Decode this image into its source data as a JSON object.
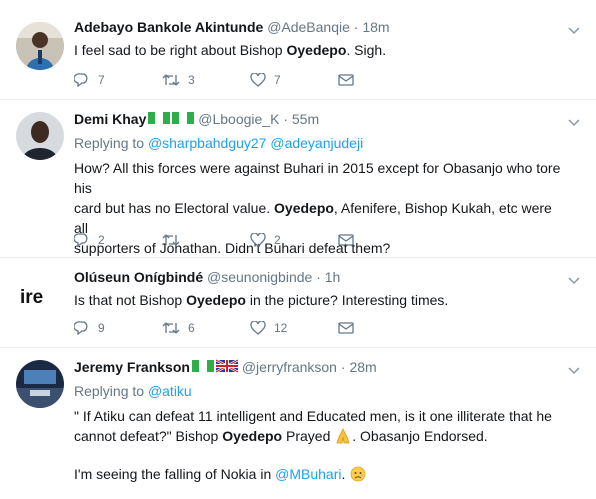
{
  "tweets": [
    {
      "name": "Adebayo Bankole Akintunde",
      "handle": "@AdeBanqie",
      "dot": "·",
      "time": "18m",
      "text_a": "I feel sad to be right about Bishop ",
      "text_b": "Oyedepo",
      "text_c": ". Sigh.",
      "replies": "7",
      "retweets": "3",
      "likes": "7"
    },
    {
      "name": "Demi Khay",
      "handle": "@Lboogie_K",
      "dot": "·",
      "time": "55m",
      "replying_label": "Replying to",
      "mention_1": "@sharpbahdguy27",
      "mention_2": "@adeyanjudeji",
      "line1": "How? All this forces were against Buhari in 2015 except for Obasanjo who tore his",
      "line2_a": "card but has no Electoral value. ",
      "line2_b": "Oyedepo",
      "line2_c": ", Afenifere, Bishop Kukah, etc were all",
      "line3": "supporters of Jonathan. Didn't Buhari defeat them?",
      "replies": "2",
      "retweets": "",
      "likes": "2"
    },
    {
      "name": "Olúseun Onígbindé",
      "handle": "@seunonigbinde",
      "dot": "·",
      "time": "1h",
      "avatar_text": "ire",
      "text_a": "Is that not Bishop ",
      "text_b": "Oyedepo",
      "text_c": " in the picture? Interesting times.",
      "replies": "9",
      "retweets": "6",
      "likes": "12"
    },
    {
      "name": "Jeremy Frankson",
      "handle": "@jerryfrankson",
      "dot": "·",
      "time": "28m",
      "replying_label": "Replying to",
      "mention_1": "@atiku",
      "line1": "\" If Atiku can defeat 11 intelligent and Educated men, is it one illiterate that he",
      "line2_a": "cannot defeat?\" Bishop ",
      "line2_b": "Oyedepo",
      "line2_c": " Prayed",
      "line2_d": ". Obasanjo Endorsed.",
      "line3_a": "I'm seeing the falling of Nokia in ",
      "line3_mention": "@MBuhari",
      "line3_c": "."
    }
  ],
  "colors": {
    "accent": "#1da1f2",
    "muted": "#657786",
    "text": "#14171a",
    "divider": "#e6ecf0"
  },
  "icons": [
    "reply-icon",
    "retweet-icon",
    "like-icon",
    "message-icon",
    "chevron-down-icon"
  ]
}
